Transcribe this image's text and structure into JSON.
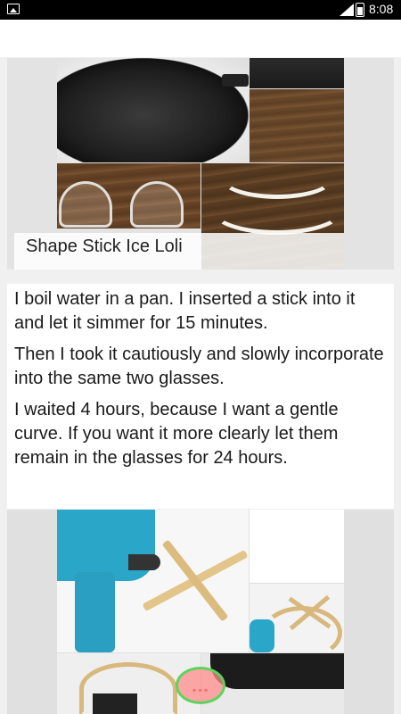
{
  "status_bar": {
    "time": "8:08",
    "icons": [
      "image-notification-icon",
      "signal-icon",
      "battery-icon"
    ]
  },
  "step1": {
    "title": "Shape Stick Ice Loli"
  },
  "instructions": {
    "paragraphs": [
      "I boil water in a pan. I inserted a stick into it and let it simmer for 15 minutes.",
      "Then I took it cautiously and slowly incorporate into the same two glasses.",
      "I waited 4 hours, because I want a gentle curve. If you want it more clearly let them remain in the glasses for 24 hours."
    ]
  },
  "fab": {
    "label": "..."
  }
}
